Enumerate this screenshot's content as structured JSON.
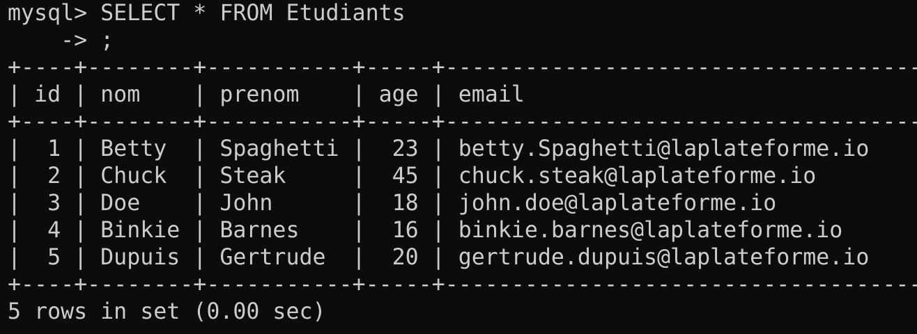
{
  "session": {
    "prompt_line": "mysql> SELECT * FROM Etudiants",
    "continuation_line": "    -> ;"
  },
  "table": {
    "border_top": "+----+--------+-----------+-----+------------------------------------+",
    "header_row": "| id | nom    | prenom    | age | email                              |",
    "border_mid": "+----+--------+-----------+-----+------------------------------------+",
    "columns": [
      "id",
      "nom",
      "prenom",
      "age",
      "email"
    ],
    "rows": [
      {
        "text": "|  1 | Betty  | Spaghetti |  23 | betty.Spaghetti@laplateforme.io    |",
        "id": "1",
        "nom": "Betty",
        "prenom": "Spaghetti",
        "age": "23",
        "email": "betty.Spaghetti@laplateforme.io"
      },
      {
        "text": "|  2 | Chuck  | Steak     |  45 | chuck.steak@laplateforme.io        |",
        "id": "2",
        "nom": "Chuck",
        "prenom": "Steak",
        "age": "45",
        "email": "chuck.steak@laplateforme.io"
      },
      {
        "text": "|  3 | Doe    | John      |  18 | john.doe@laplateforme.io           |",
        "id": "3",
        "nom": "Doe",
        "prenom": "John",
        "age": "18",
        "email": "john.doe@laplateforme.io"
      },
      {
        "text": "|  4 | Binkie | Barnes    |  16 | binkie.barnes@laplateforme.io      |",
        "id": "4",
        "nom": "Binkie",
        "prenom": "Barnes",
        "age": "16",
        "email": "binkie.barnes@laplateforme.io"
      },
      {
        "text": "|  5 | Dupuis | Gertrude  |  20 | gertrude.dupuis@laplateforme.io    |",
        "id": "5",
        "nom": "Dupuis",
        "prenom": "Gertrude",
        "age": "20",
        "email": "gertrude.dupuis@laplateforme.io"
      }
    ],
    "border_bottom": "+----+--------+-----------+-----+------------------------------------+"
  },
  "result_summary": "5 rows in set (0.00 sec)",
  "colors": {
    "background": "#0c0c0c",
    "foreground": "#cccccc"
  }
}
